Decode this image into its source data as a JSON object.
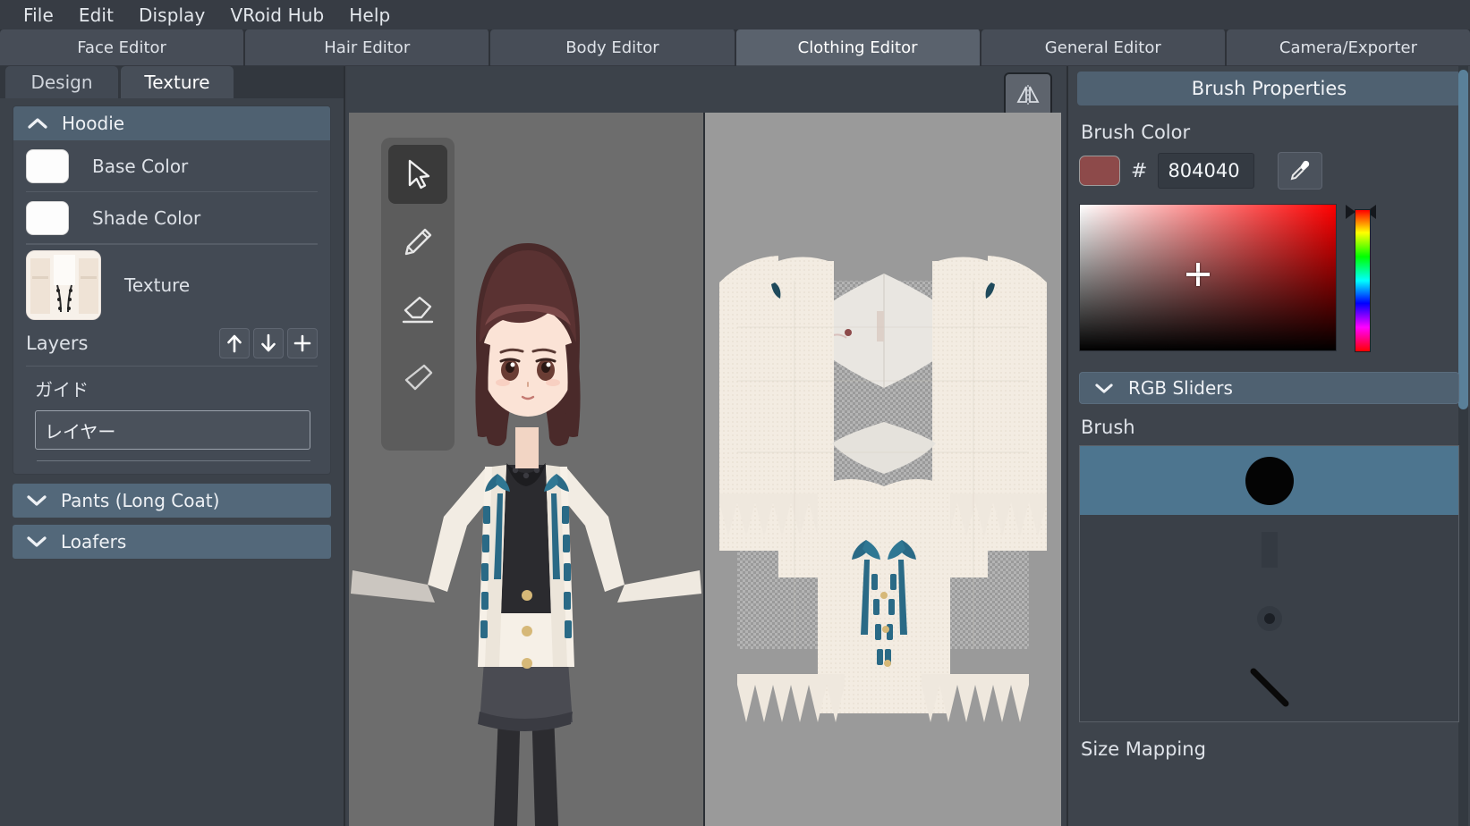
{
  "menubar": {
    "items": [
      {
        "label": "File"
      },
      {
        "label": "Edit"
      },
      {
        "label": "Display"
      },
      {
        "label": "VRoid Hub"
      },
      {
        "label": "Help"
      }
    ]
  },
  "editor_tabs": {
    "active": "Clothing Editor",
    "items": [
      {
        "label": "Face Editor"
      },
      {
        "label": "Hair Editor"
      },
      {
        "label": "Body Editor"
      },
      {
        "label": "Clothing Editor"
      },
      {
        "label": "General Editor"
      },
      {
        "label": "Camera/Exporter"
      }
    ]
  },
  "left_panel": {
    "subtabs": {
      "active": "Texture",
      "items": [
        {
          "label": "Design"
        },
        {
          "label": "Texture"
        }
      ]
    },
    "groups": [
      {
        "title": "Hoodie",
        "expanded": true,
        "chevron": "chevron-up-icon",
        "rows": [
          {
            "label": "Base Color",
            "swatch_color": "#fdfdfd",
            "icon": "color-swatch"
          },
          {
            "label": "Shade Color",
            "swatch_color": "#fdfdfd",
            "icon": "color-swatch"
          }
        ],
        "texture_row": {
          "label": "Texture"
        },
        "layers": {
          "title": "Layers",
          "buttons": [
            {
              "icon": "arrow-up-icon",
              "name": "move-layer-up"
            },
            {
              "icon": "arrow-down-icon",
              "name": "move-layer-down"
            },
            {
              "icon": "plus-icon",
              "name": "add-layer"
            }
          ],
          "group_name": "ガイド",
          "items": [
            {
              "label": "レイヤー"
            }
          ]
        }
      },
      {
        "title": "Pants (Long Coat)",
        "expanded": false,
        "chevron": "chevron-down-icon"
      },
      {
        "title": "Loafers",
        "expanded": false,
        "chevron": "chevron-down-icon"
      }
    ]
  },
  "viewport": {
    "mirror_button": {
      "icon": "mirror-symmetry-icon",
      "name": "mirror-toggle"
    },
    "tools": [
      {
        "name": "select-tool",
        "icon": "cursor-arrow-icon",
        "active": true
      },
      {
        "name": "pencil-tool",
        "icon": "pencil-icon",
        "active": false
      },
      {
        "name": "eraser-tool",
        "icon": "eraser-icon",
        "active": false
      },
      {
        "name": "fill-tool",
        "icon": "fill-bucket-icon",
        "active": false
      }
    ]
  },
  "right_panel": {
    "title": "Brush Properties",
    "brush_color": {
      "label": "Brush Color",
      "hash_symbol": "#",
      "hex_value": "804040",
      "swatch_color": "#8d4a4a",
      "eyedropper": {
        "icon": "eyedropper-icon",
        "name": "color-picker-eyedropper"
      }
    },
    "rgb_sliders": {
      "label": "RGB Sliders",
      "chevron": "chevron-down-icon",
      "expanded": false
    },
    "brush": {
      "label": "Brush",
      "items": [
        {
          "name": "brush-hard-round",
          "active": true
        },
        {
          "name": "brush-soft-square",
          "active": false
        },
        {
          "name": "brush-small-dot",
          "active": false
        },
        {
          "name": "brush-diagonal-stroke",
          "active": false
        }
      ]
    },
    "size_mapping": {
      "label": "Size Mapping"
    }
  },
  "colors": {
    "menubar_bg": "#373c44",
    "tab_bg": "#474d57",
    "tab_active_bg": "#5a626d",
    "panel_bg": "#3c424a",
    "group_header_bg": "#4f6171",
    "accent_blue": "#4d758f",
    "text": "#dfe3e9",
    "viewport_model_bg": "#6d6d6d",
    "viewport_uv_bg": "#9a9a9a"
  }
}
